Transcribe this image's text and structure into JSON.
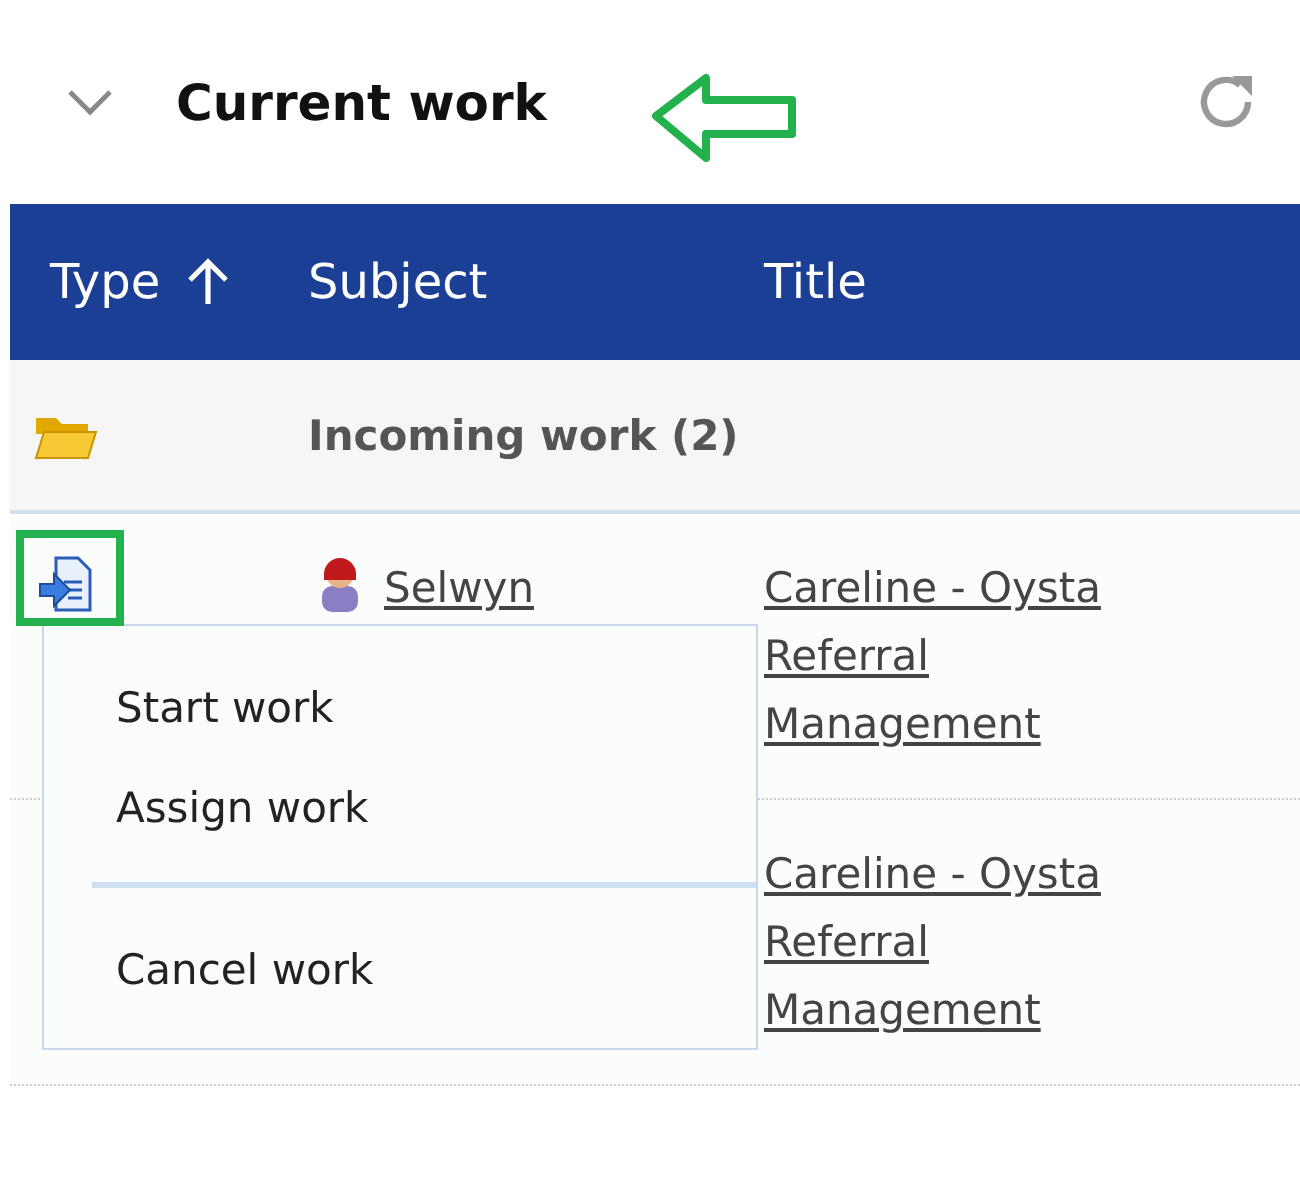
{
  "panel": {
    "title": "Current work",
    "expanded": true
  },
  "table": {
    "columns": [
      {
        "label": "Type",
        "sorted": true
      },
      {
        "label": "Subject",
        "sorted": false
      },
      {
        "label": "Title",
        "sorted": false
      }
    ],
    "group": {
      "label": "Incoming work (2)",
      "expanded": true
    },
    "rows": [
      {
        "icon_visible": true,
        "subject": "Selwyn",
        "title": "Careline - Oysta Referral Management"
      },
      {
        "icon_visible": false,
        "title": "Careline - Oysta Referral Management"
      }
    ]
  },
  "context_menu": {
    "items": [
      {
        "kind": "action",
        "label": "Start work"
      },
      {
        "kind": "action",
        "label": "Assign work"
      },
      {
        "kind": "separator"
      },
      {
        "kind": "action",
        "label": "Cancel work"
      }
    ]
  },
  "annotations": {
    "arrow": true,
    "highlight_box": true
  }
}
